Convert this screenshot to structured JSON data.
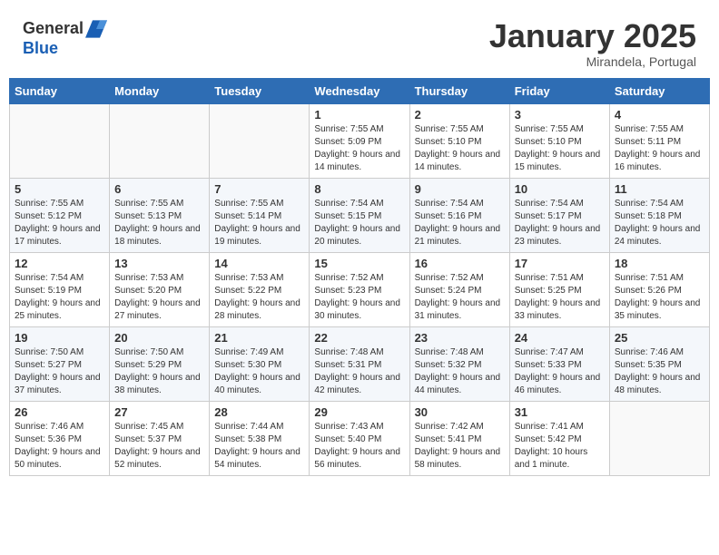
{
  "header": {
    "logo_line1": "General",
    "logo_line2": "Blue",
    "month": "January 2025",
    "location": "Mirandela, Portugal"
  },
  "weekdays": [
    "Sunday",
    "Monday",
    "Tuesday",
    "Wednesday",
    "Thursday",
    "Friday",
    "Saturday"
  ],
  "weeks": [
    [
      {
        "day": "",
        "info": ""
      },
      {
        "day": "",
        "info": ""
      },
      {
        "day": "",
        "info": ""
      },
      {
        "day": "1",
        "info": "Sunrise: 7:55 AM\nSunset: 5:09 PM\nDaylight: 9 hours\nand 14 minutes."
      },
      {
        "day": "2",
        "info": "Sunrise: 7:55 AM\nSunset: 5:10 PM\nDaylight: 9 hours\nand 14 minutes."
      },
      {
        "day": "3",
        "info": "Sunrise: 7:55 AM\nSunset: 5:10 PM\nDaylight: 9 hours\nand 15 minutes."
      },
      {
        "day": "4",
        "info": "Sunrise: 7:55 AM\nSunset: 5:11 PM\nDaylight: 9 hours\nand 16 minutes."
      }
    ],
    [
      {
        "day": "5",
        "info": "Sunrise: 7:55 AM\nSunset: 5:12 PM\nDaylight: 9 hours\nand 17 minutes."
      },
      {
        "day": "6",
        "info": "Sunrise: 7:55 AM\nSunset: 5:13 PM\nDaylight: 9 hours\nand 18 minutes."
      },
      {
        "day": "7",
        "info": "Sunrise: 7:55 AM\nSunset: 5:14 PM\nDaylight: 9 hours\nand 19 minutes."
      },
      {
        "day": "8",
        "info": "Sunrise: 7:54 AM\nSunset: 5:15 PM\nDaylight: 9 hours\nand 20 minutes."
      },
      {
        "day": "9",
        "info": "Sunrise: 7:54 AM\nSunset: 5:16 PM\nDaylight: 9 hours\nand 21 minutes."
      },
      {
        "day": "10",
        "info": "Sunrise: 7:54 AM\nSunset: 5:17 PM\nDaylight: 9 hours\nand 23 minutes."
      },
      {
        "day": "11",
        "info": "Sunrise: 7:54 AM\nSunset: 5:18 PM\nDaylight: 9 hours\nand 24 minutes."
      }
    ],
    [
      {
        "day": "12",
        "info": "Sunrise: 7:54 AM\nSunset: 5:19 PM\nDaylight: 9 hours\nand 25 minutes."
      },
      {
        "day": "13",
        "info": "Sunrise: 7:53 AM\nSunset: 5:20 PM\nDaylight: 9 hours\nand 27 minutes."
      },
      {
        "day": "14",
        "info": "Sunrise: 7:53 AM\nSunset: 5:22 PM\nDaylight: 9 hours\nand 28 minutes."
      },
      {
        "day": "15",
        "info": "Sunrise: 7:52 AM\nSunset: 5:23 PM\nDaylight: 9 hours\nand 30 minutes."
      },
      {
        "day": "16",
        "info": "Sunrise: 7:52 AM\nSunset: 5:24 PM\nDaylight: 9 hours\nand 31 minutes."
      },
      {
        "day": "17",
        "info": "Sunrise: 7:51 AM\nSunset: 5:25 PM\nDaylight: 9 hours\nand 33 minutes."
      },
      {
        "day": "18",
        "info": "Sunrise: 7:51 AM\nSunset: 5:26 PM\nDaylight: 9 hours\nand 35 minutes."
      }
    ],
    [
      {
        "day": "19",
        "info": "Sunrise: 7:50 AM\nSunset: 5:27 PM\nDaylight: 9 hours\nand 37 minutes."
      },
      {
        "day": "20",
        "info": "Sunrise: 7:50 AM\nSunset: 5:29 PM\nDaylight: 9 hours\nand 38 minutes."
      },
      {
        "day": "21",
        "info": "Sunrise: 7:49 AM\nSunset: 5:30 PM\nDaylight: 9 hours\nand 40 minutes."
      },
      {
        "day": "22",
        "info": "Sunrise: 7:48 AM\nSunset: 5:31 PM\nDaylight: 9 hours\nand 42 minutes."
      },
      {
        "day": "23",
        "info": "Sunrise: 7:48 AM\nSunset: 5:32 PM\nDaylight: 9 hours\nand 44 minutes."
      },
      {
        "day": "24",
        "info": "Sunrise: 7:47 AM\nSunset: 5:33 PM\nDaylight: 9 hours\nand 46 minutes."
      },
      {
        "day": "25",
        "info": "Sunrise: 7:46 AM\nSunset: 5:35 PM\nDaylight: 9 hours\nand 48 minutes."
      }
    ],
    [
      {
        "day": "26",
        "info": "Sunrise: 7:46 AM\nSunset: 5:36 PM\nDaylight: 9 hours\nand 50 minutes."
      },
      {
        "day": "27",
        "info": "Sunrise: 7:45 AM\nSunset: 5:37 PM\nDaylight: 9 hours\nand 52 minutes."
      },
      {
        "day": "28",
        "info": "Sunrise: 7:44 AM\nSunset: 5:38 PM\nDaylight: 9 hours\nand 54 minutes."
      },
      {
        "day": "29",
        "info": "Sunrise: 7:43 AM\nSunset: 5:40 PM\nDaylight: 9 hours\nand 56 minutes."
      },
      {
        "day": "30",
        "info": "Sunrise: 7:42 AM\nSunset: 5:41 PM\nDaylight: 9 hours\nand 58 minutes."
      },
      {
        "day": "31",
        "info": "Sunrise: 7:41 AM\nSunset: 5:42 PM\nDaylight: 10 hours\nand 1 minute."
      },
      {
        "day": "",
        "info": ""
      }
    ]
  ]
}
